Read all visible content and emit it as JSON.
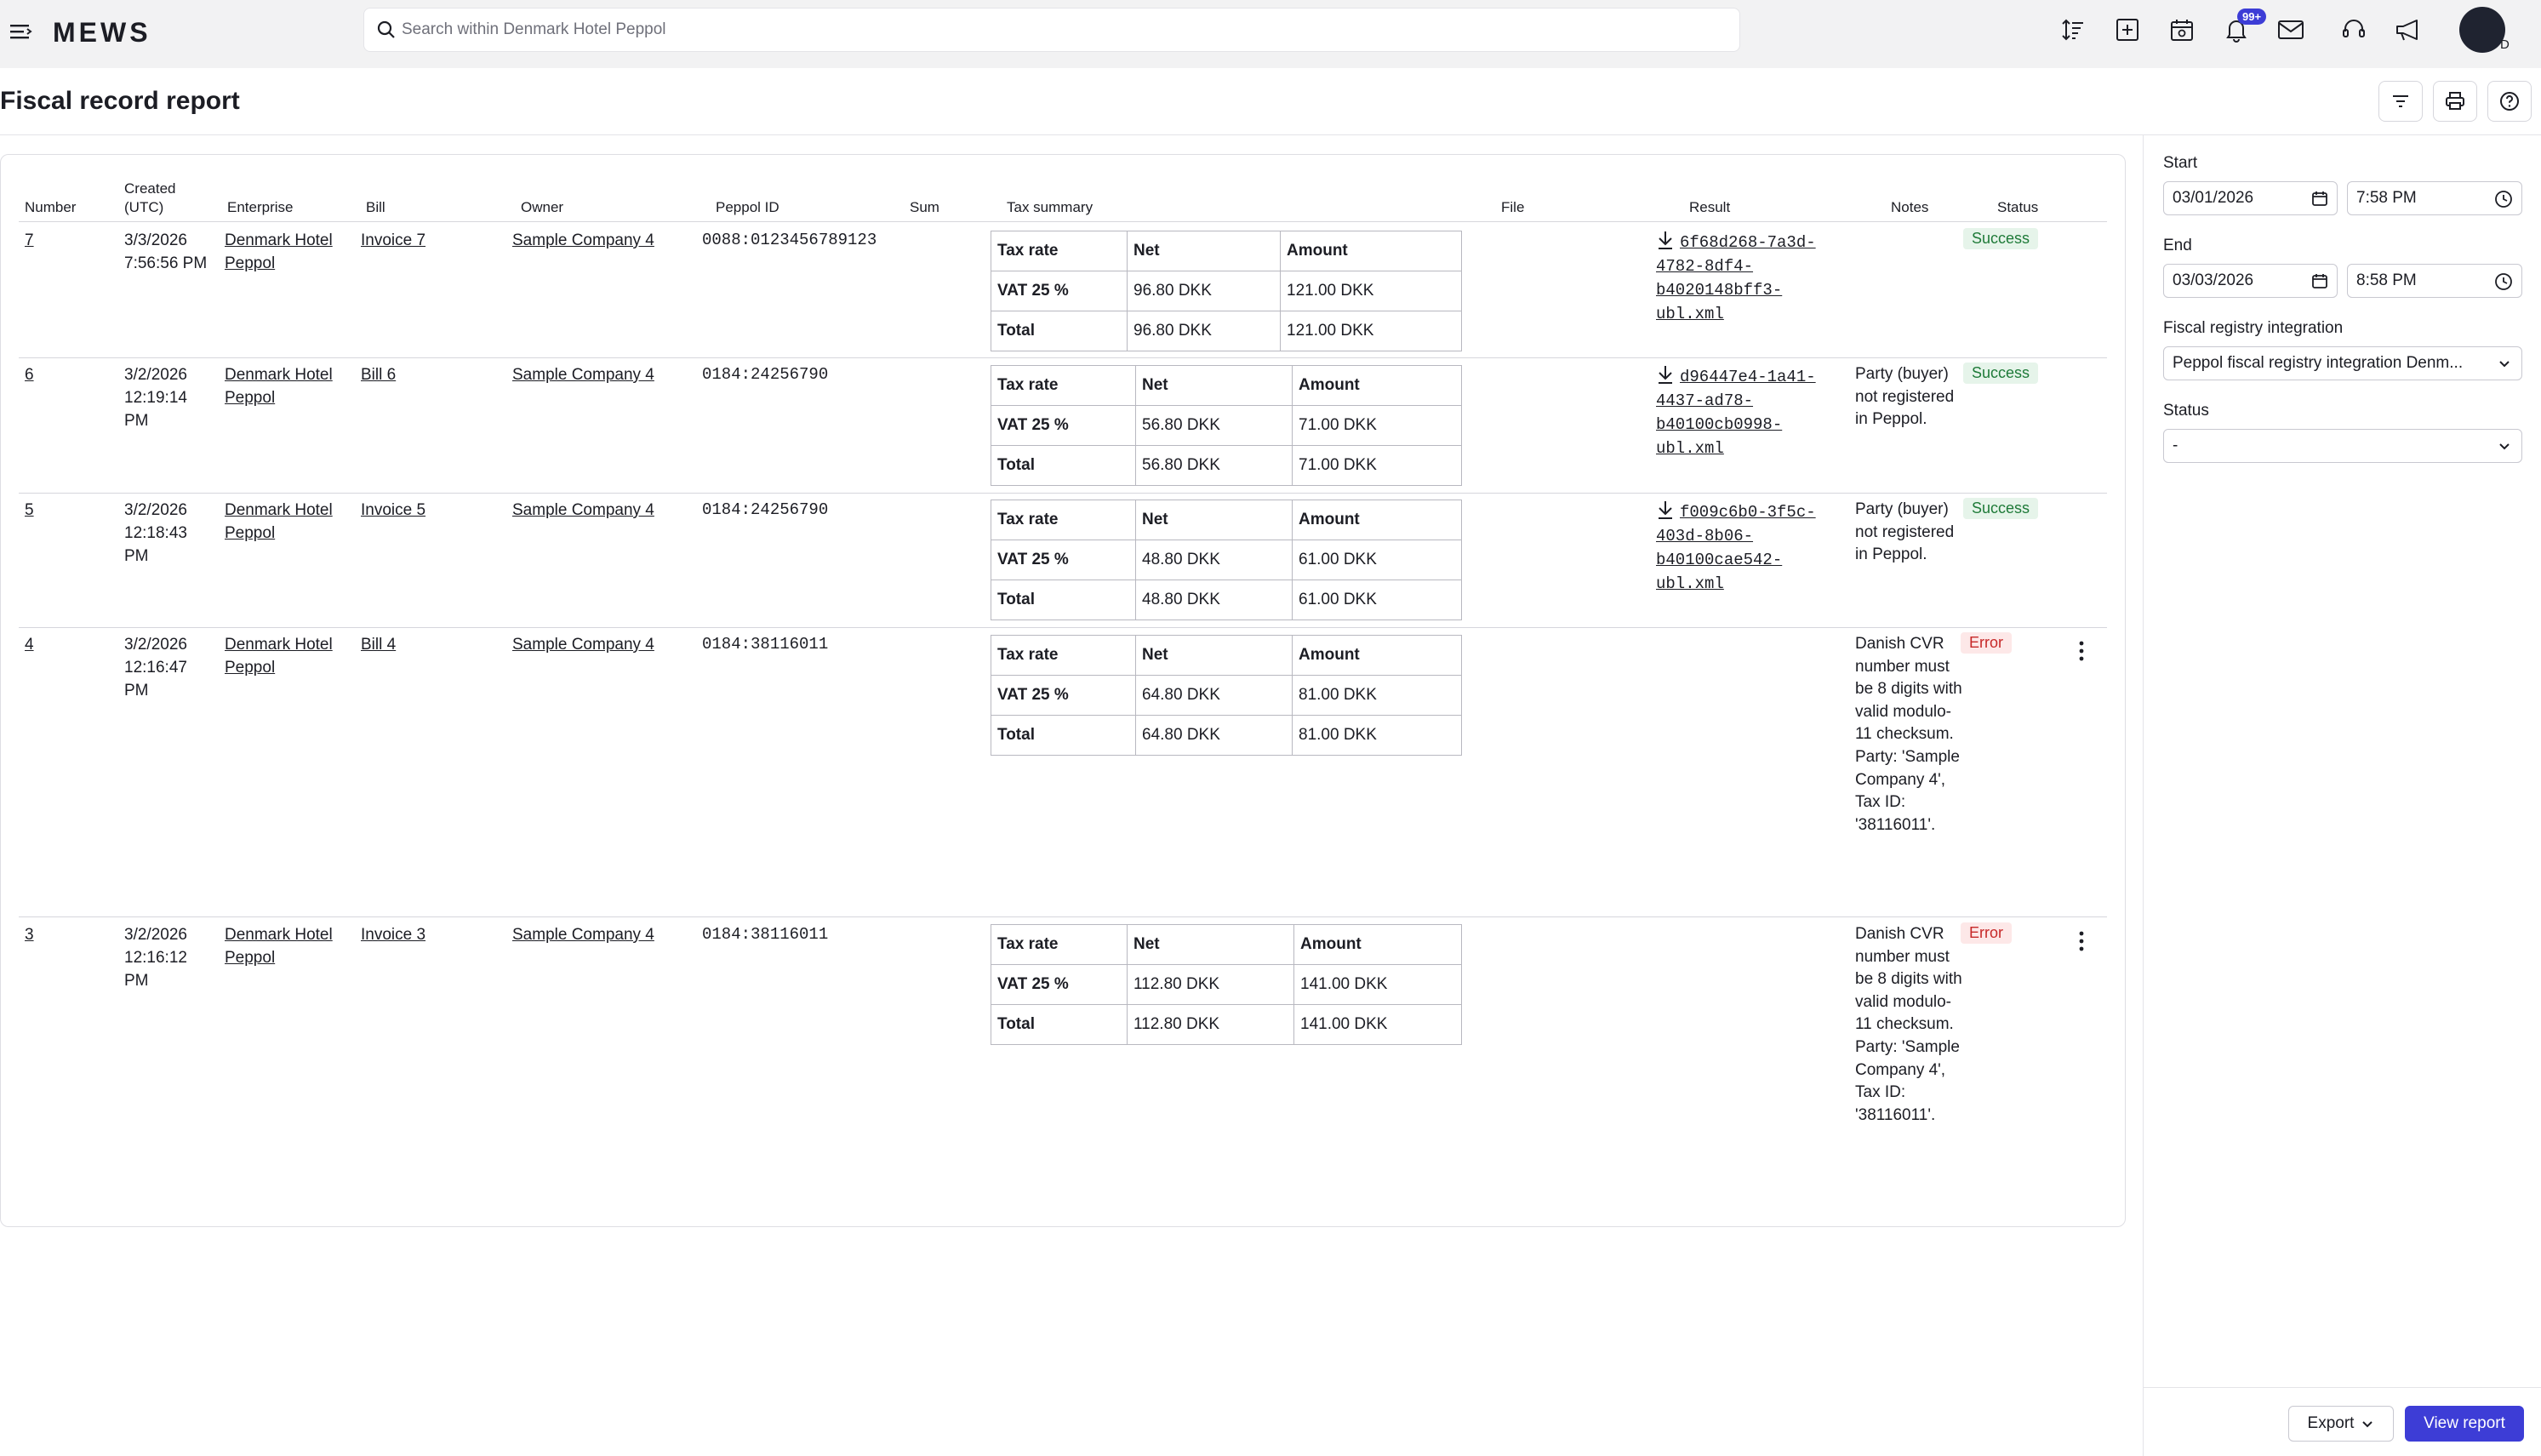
{
  "header": {
    "logo": "MEWS",
    "search_placeholder": "Search within Denmark Hotel Peppol",
    "notifications_badge": "99+",
    "avatar_initial": "D",
    "icons": [
      "sort-icon",
      "add-square-icon",
      "calendar-search-icon",
      "bell-icon",
      "mail-icon",
      "headset-icon",
      "megaphone-icon"
    ]
  },
  "page": {
    "title": "Fiscal record report"
  },
  "table": {
    "columns": {
      "number": "Number",
      "created": "Created (UTC)",
      "enterprise": "Enterprise",
      "bill": "Bill",
      "owner": "Owner",
      "peppol_id": "Peppol ID",
      "sum": "Sum",
      "tax_summary": "Tax summary",
      "file": "File",
      "result": "Result",
      "notes": "Notes",
      "status": "Status"
    },
    "tax_headers": {
      "rate": "Tax rate",
      "net": "Net",
      "amount": "Amount"
    },
    "rows": [
      {
        "number": "7",
        "created": "3/3/2026 7:56:56 PM",
        "enterprise": "Denmark Hotel Peppol",
        "bill": "Invoice 7",
        "owner": "Sample Company 4",
        "peppol_id": "0088:0123456789123",
        "tax_rate": "VAT 25 %",
        "net": "96.80 DKK",
        "amount": "121.00 DKK",
        "total_label": "Total",
        "total_net": "96.80 DKK",
        "total_amount": "121.00 DKK",
        "result": "6f68d268-7a3d-4782-8df4-b4020148bff3-ubl.xml",
        "notes": "",
        "status": "Success"
      },
      {
        "number": "6",
        "created": "3/2/2026 12:19:14 PM",
        "enterprise": "Denmark Hotel Peppol",
        "bill": "Bill 6",
        "owner": "Sample Company 4",
        "peppol_id": "0184:24256790",
        "tax_rate": "VAT 25 %",
        "net": "56.80 DKK",
        "amount": "71.00 DKK",
        "total_label": "Total",
        "total_net": "56.80 DKK",
        "total_amount": "71.00 DKK",
        "result": "d96447e4-1a41-4437-ad78-b40100cb0998-ubl.xml",
        "notes": "Party (buyer) not registered in Peppol.",
        "status": "Success"
      },
      {
        "number": "5",
        "created": "3/2/2026 12:18:43 PM",
        "enterprise": "Denmark Hotel Peppol",
        "bill": "Invoice 5",
        "owner": "Sample Company 4",
        "peppol_id": "0184:24256790",
        "tax_rate": "VAT 25 %",
        "net": "48.80 DKK",
        "amount": "61.00 DKK",
        "total_label": "Total",
        "total_net": "48.80 DKK",
        "total_amount": "61.00 DKK",
        "result": "f009c6b0-3f5c-403d-8b06-b40100cae542-ubl.xml",
        "notes": "Party (buyer) not registered in Peppol.",
        "status": "Success"
      },
      {
        "number": "4",
        "created": "3/2/2026 12:16:47 PM",
        "enterprise": "Denmark Hotel Peppol",
        "bill": "Bill 4",
        "owner": "Sample Company 4",
        "peppol_id": "0184:38116011",
        "tax_rate": "VAT 25 %",
        "net": "64.80 DKK",
        "amount": "81.00 DKK",
        "total_label": "Total",
        "total_net": "64.80 DKK",
        "total_amount": "81.00 DKK",
        "result": "",
        "notes": "Danish CVR number must be 8 digits with valid modulo-11 checksum. Party: 'Sample Company 4', Tax ID: '38116011'.",
        "status": "Error"
      },
      {
        "number": "3",
        "created": "3/2/2026 12:16:12 PM",
        "enterprise": "Denmark Hotel Peppol",
        "bill": "Invoice 3",
        "owner": "Sample Company 4",
        "peppol_id": "0184:38116011",
        "tax_rate": "VAT 25 %",
        "net": "112.80 DKK",
        "amount": "141.00 DKK",
        "total_label": "Total",
        "total_net": "112.80 DKK",
        "total_amount": "141.00 DKK",
        "result": "",
        "notes": "Danish CVR number must be 8 digits with valid modulo-11 checksum. Party: 'Sample Company 4', Tax ID: '38116011'.",
        "status": "Error"
      }
    ]
  },
  "filters": {
    "start_label": "Start",
    "start_date": "03/01/2026",
    "start_time": "7:58 PM",
    "end_label": "End",
    "end_date": "03/03/2026",
    "end_time": "8:58 PM",
    "integration_label": "Fiscal registry integration",
    "integration_value": "Peppol fiscal registry integration Denm...",
    "status_label": "Status",
    "status_value": "-",
    "export_label": "Export",
    "view_report_label": "View report"
  },
  "colors": {
    "accent": "#3d3dd6",
    "success_bg": "#e6f4ea",
    "success_text": "#1e7a38",
    "error_bg": "#fde8e8",
    "error_text": "#c62828"
  }
}
